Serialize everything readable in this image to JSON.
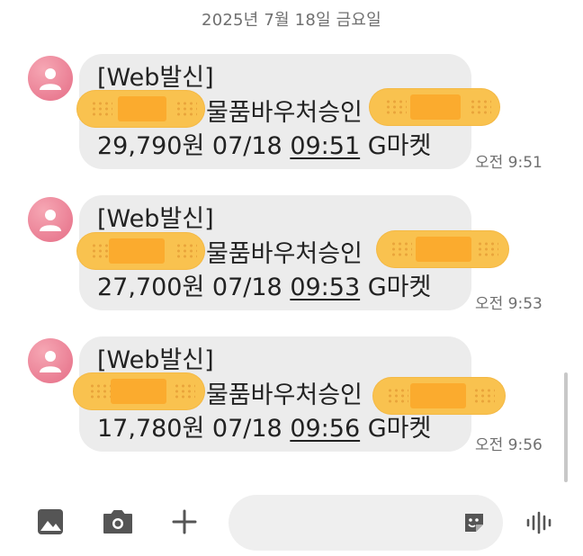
{
  "date_header": "2025년 7월 18일 금요일",
  "messages": [
    {
      "header": "[Web발신]",
      "line2": "물품바우처승인",
      "amount": "29,790원 07/18",
      "time_in_text": "09:51",
      "merchant": "G마켓",
      "timestamp": "오전 9:51"
    },
    {
      "header": "[Web발신]",
      "line2": "물품바우처승인",
      "amount": "27,700원 07/18",
      "time_in_text": "09:53",
      "merchant": "G마켓",
      "timestamp": "오전 9:53"
    },
    {
      "header": "[Web발신]",
      "line2": "물품바우처승인",
      "amount": "17,780원 07/18",
      "time_in_text": "09:56",
      "merchant": "G마켓",
      "timestamp": "오전 9:56"
    }
  ],
  "composer": {
    "placeholder": "",
    "icons": [
      "gallery-icon",
      "camera-icon",
      "plus-icon",
      "sticker-icon",
      "voice-icon"
    ]
  },
  "colors": {
    "bubble": "#ececec",
    "avatar": "#e56d86",
    "bandage": "#f9c24f",
    "secondary_text": "#6f6f6f"
  }
}
